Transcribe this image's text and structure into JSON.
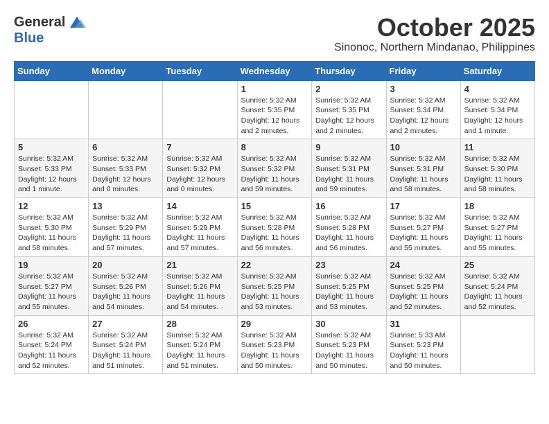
{
  "logo": {
    "general": "General",
    "blue": "Blue"
  },
  "title": "October 2025",
  "location": "Sinonoc, Northern Mindanao, Philippines",
  "days_of_week": [
    "Sunday",
    "Monday",
    "Tuesday",
    "Wednesday",
    "Thursday",
    "Friday",
    "Saturday"
  ],
  "weeks": [
    [
      {
        "day": "",
        "info": ""
      },
      {
        "day": "",
        "info": ""
      },
      {
        "day": "",
        "info": ""
      },
      {
        "day": "1",
        "info": "Sunrise: 5:32 AM\nSunset: 5:35 PM\nDaylight: 12 hours and 2 minutes."
      },
      {
        "day": "2",
        "info": "Sunrise: 5:32 AM\nSunset: 5:35 PM\nDaylight: 12 hours and 2 minutes."
      },
      {
        "day": "3",
        "info": "Sunrise: 5:32 AM\nSunset: 5:34 PM\nDaylight: 12 hours and 2 minutes."
      },
      {
        "day": "4",
        "info": "Sunrise: 5:32 AM\nSunset: 5:34 PM\nDaylight: 12 hours and 1 minute."
      }
    ],
    [
      {
        "day": "5",
        "info": "Sunrise: 5:32 AM\nSunset: 5:33 PM\nDaylight: 12 hours and 1 minute."
      },
      {
        "day": "6",
        "info": "Sunrise: 5:32 AM\nSunset: 5:33 PM\nDaylight: 12 hours and 0 minutes."
      },
      {
        "day": "7",
        "info": "Sunrise: 5:32 AM\nSunset: 5:32 PM\nDaylight: 12 hours and 0 minutes."
      },
      {
        "day": "8",
        "info": "Sunrise: 5:32 AM\nSunset: 5:32 PM\nDaylight: 11 hours and 59 minutes."
      },
      {
        "day": "9",
        "info": "Sunrise: 5:32 AM\nSunset: 5:31 PM\nDaylight: 11 hours and 59 minutes."
      },
      {
        "day": "10",
        "info": "Sunrise: 5:32 AM\nSunset: 5:31 PM\nDaylight: 11 hours and 58 minutes."
      },
      {
        "day": "11",
        "info": "Sunrise: 5:32 AM\nSunset: 5:30 PM\nDaylight: 11 hours and 58 minutes."
      }
    ],
    [
      {
        "day": "12",
        "info": "Sunrise: 5:32 AM\nSunset: 5:30 PM\nDaylight: 11 hours and 58 minutes."
      },
      {
        "day": "13",
        "info": "Sunrise: 5:32 AM\nSunset: 5:29 PM\nDaylight: 11 hours and 57 minutes."
      },
      {
        "day": "14",
        "info": "Sunrise: 5:32 AM\nSunset: 5:29 PM\nDaylight: 11 hours and 57 minutes."
      },
      {
        "day": "15",
        "info": "Sunrise: 5:32 AM\nSunset: 5:28 PM\nDaylight: 11 hours and 56 minutes."
      },
      {
        "day": "16",
        "info": "Sunrise: 5:32 AM\nSunset: 5:28 PM\nDaylight: 11 hours and 56 minutes."
      },
      {
        "day": "17",
        "info": "Sunrise: 5:32 AM\nSunset: 5:27 PM\nDaylight: 11 hours and 55 minutes."
      },
      {
        "day": "18",
        "info": "Sunrise: 5:32 AM\nSunset: 5:27 PM\nDaylight: 11 hours and 55 minutes."
      }
    ],
    [
      {
        "day": "19",
        "info": "Sunrise: 5:32 AM\nSunset: 5:27 PM\nDaylight: 11 hours and 55 minutes."
      },
      {
        "day": "20",
        "info": "Sunrise: 5:32 AM\nSunset: 5:26 PM\nDaylight: 11 hours and 54 minutes."
      },
      {
        "day": "21",
        "info": "Sunrise: 5:32 AM\nSunset: 5:26 PM\nDaylight: 11 hours and 54 minutes."
      },
      {
        "day": "22",
        "info": "Sunrise: 5:32 AM\nSunset: 5:25 PM\nDaylight: 11 hours and 53 minutes."
      },
      {
        "day": "23",
        "info": "Sunrise: 5:32 AM\nSunset: 5:25 PM\nDaylight: 11 hours and 53 minutes."
      },
      {
        "day": "24",
        "info": "Sunrise: 5:32 AM\nSunset: 5:25 PM\nDaylight: 11 hours and 52 minutes."
      },
      {
        "day": "25",
        "info": "Sunrise: 5:32 AM\nSunset: 5:24 PM\nDaylight: 11 hours and 52 minutes."
      }
    ],
    [
      {
        "day": "26",
        "info": "Sunrise: 5:32 AM\nSunset: 5:24 PM\nDaylight: 11 hours and 52 minutes."
      },
      {
        "day": "27",
        "info": "Sunrise: 5:32 AM\nSunset: 5:24 PM\nDaylight: 11 hours and 51 minutes."
      },
      {
        "day": "28",
        "info": "Sunrise: 5:32 AM\nSunset: 5:24 PM\nDaylight: 11 hours and 51 minutes."
      },
      {
        "day": "29",
        "info": "Sunrise: 5:32 AM\nSunset: 5:23 PM\nDaylight: 11 hours and 50 minutes."
      },
      {
        "day": "30",
        "info": "Sunrise: 5:32 AM\nSunset: 5:23 PM\nDaylight: 11 hours and 50 minutes."
      },
      {
        "day": "31",
        "info": "Sunrise: 5:33 AM\nSunset: 5:23 PM\nDaylight: 11 hours and 50 minutes."
      },
      {
        "day": "",
        "info": ""
      }
    ]
  ]
}
